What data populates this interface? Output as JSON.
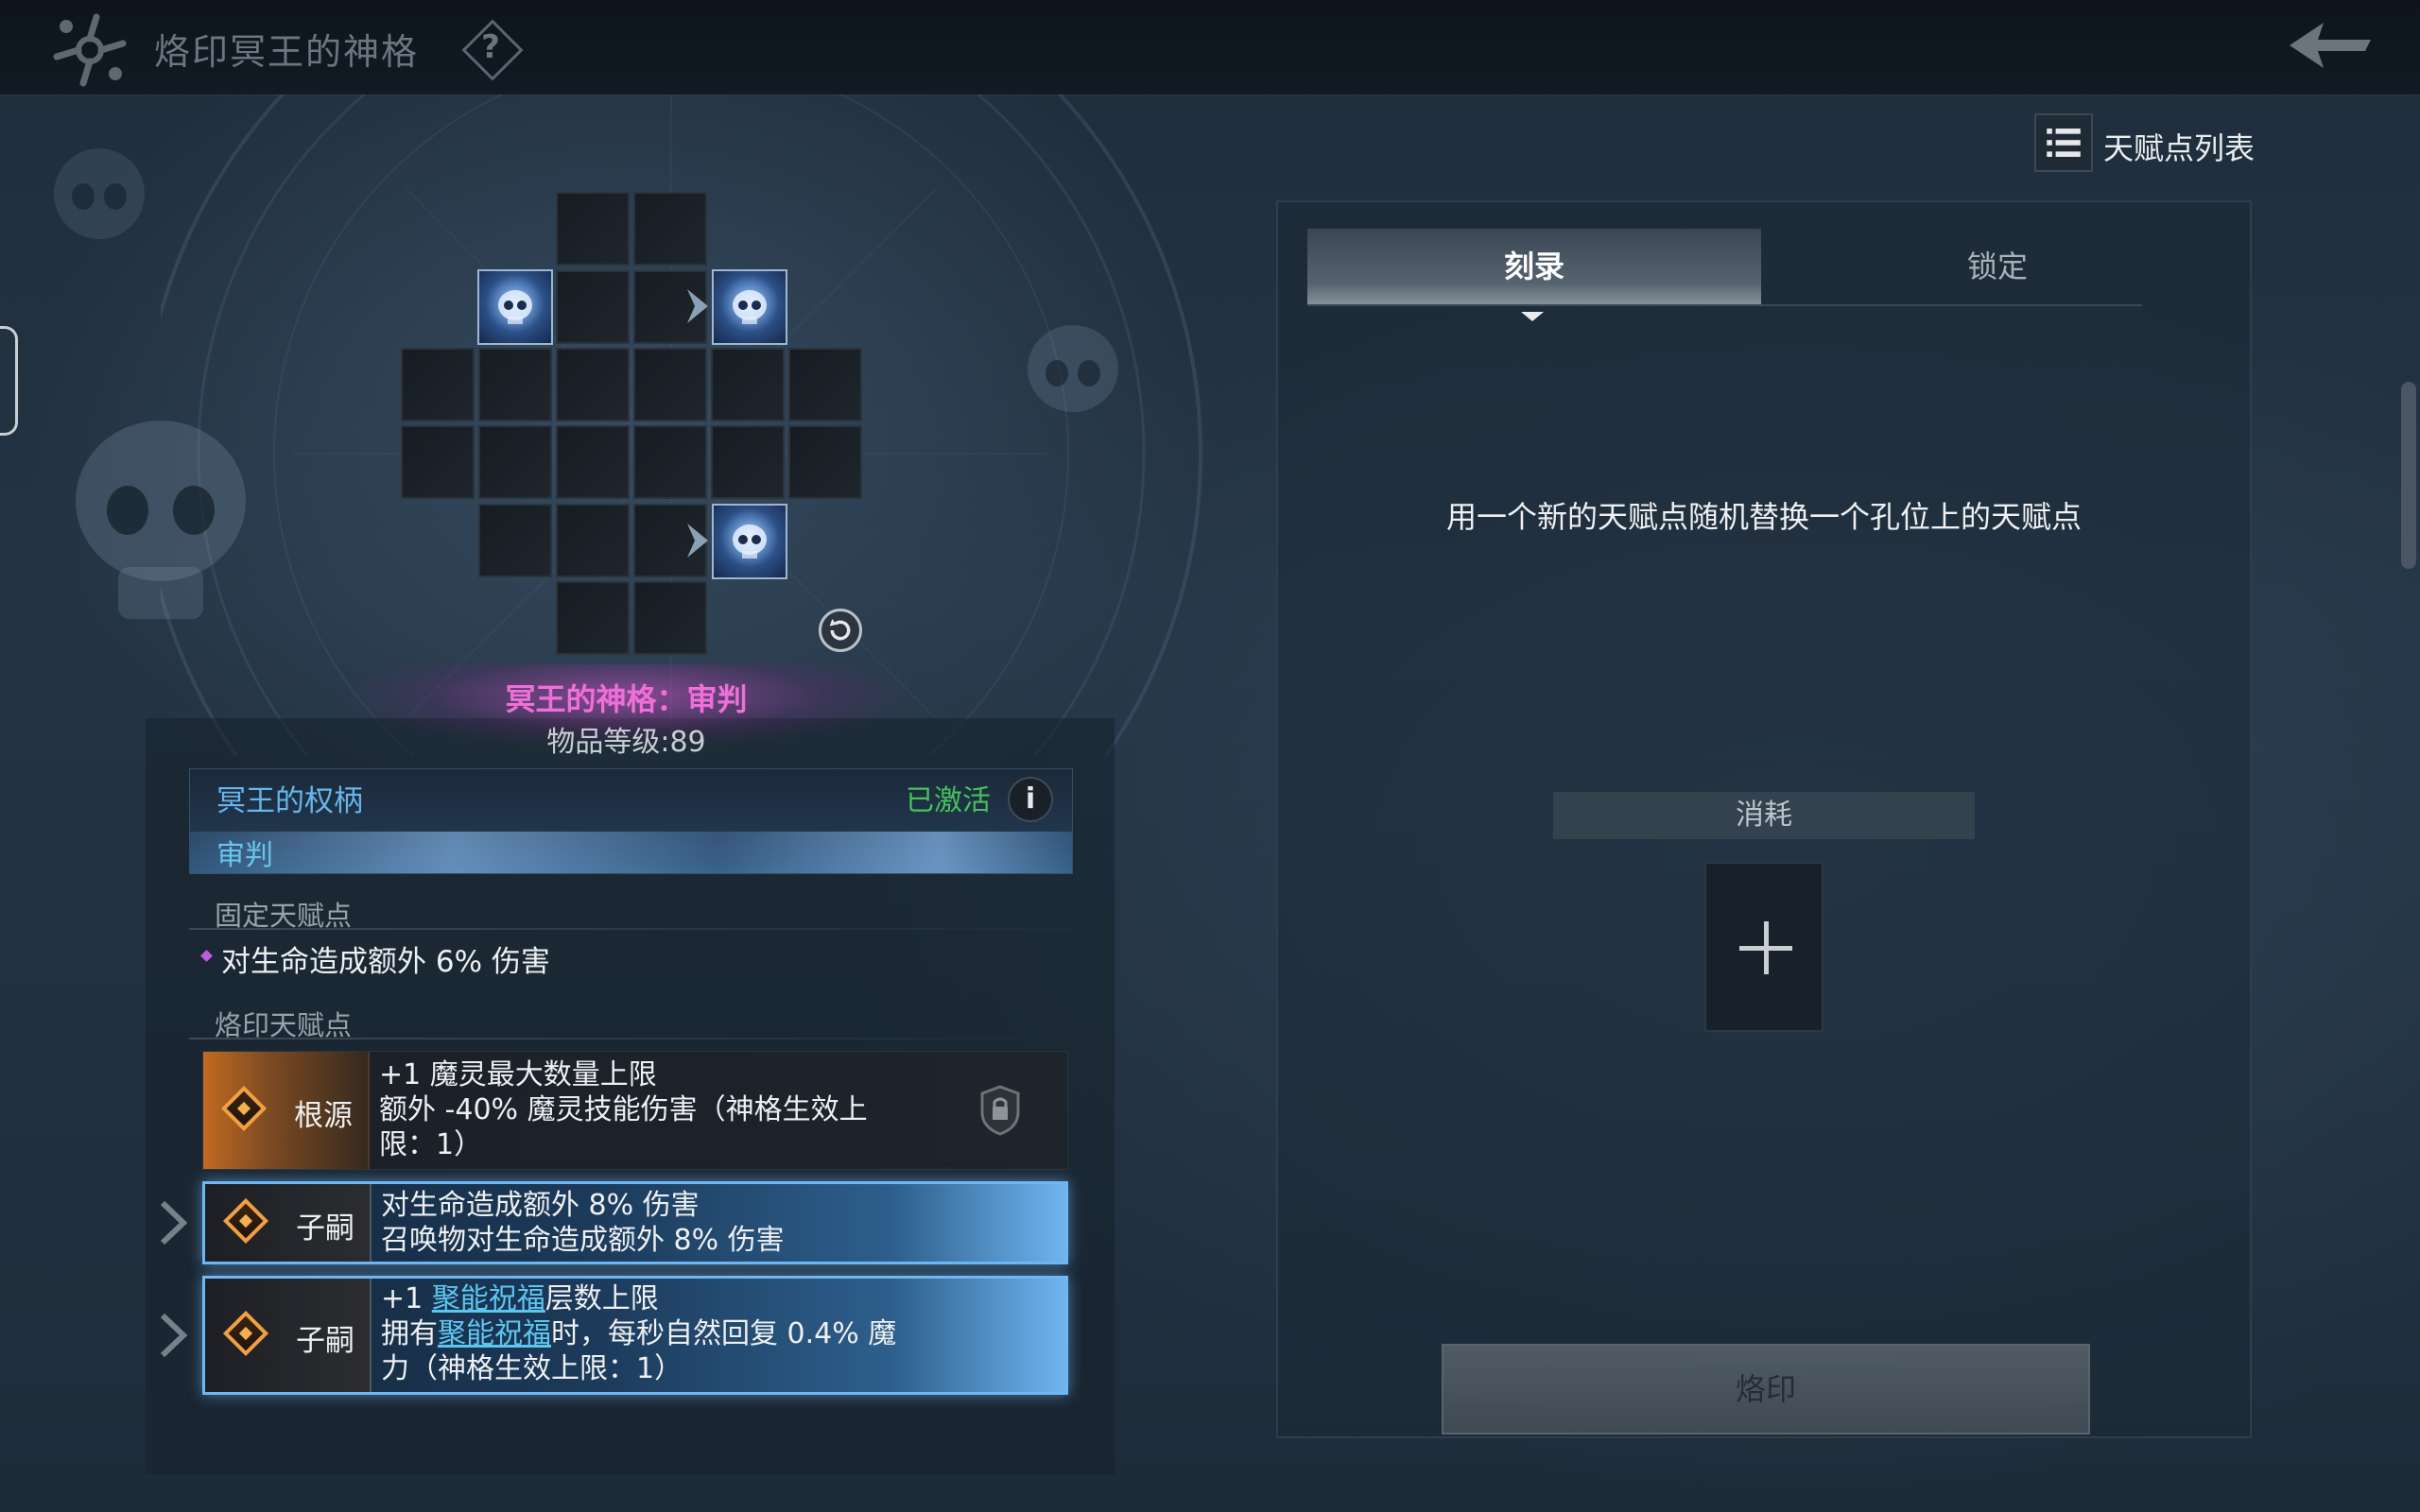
{
  "header": {
    "title": "烙印冥王的神格",
    "help_label": "?"
  },
  "item": {
    "name": "冥王的神格：审判",
    "level": "物品等级:89"
  },
  "scepter": {
    "name": "冥王的权柄",
    "sub": "审判",
    "status": "已激活",
    "info_label": "i"
  },
  "sections": {
    "fixed": "固定天赋点",
    "engraved": "烙印天赋点"
  },
  "fixed_talent": "对生命造成额外 6% 伤害",
  "talents": [
    {
      "type": "根源",
      "lines": [
        "+1 魔灵最大数量上限",
        "额外 -40% 魔灵技能伤害（神格生效上",
        "限：1）"
      ]
    },
    {
      "type": "子嗣",
      "lines": [
        "对生命造成额外 8% 伤害",
        "召唤物对生命造成额外 8% 伤害"
      ]
    },
    {
      "type": "子嗣",
      "line1_pre": "+1 ",
      "line1_link": "聚能祝福",
      "line1_post": "层数上限",
      "line2_pre": "拥有",
      "line2_link": "聚能祝福",
      "line2_post": "时，每秒自然回复 0.4% 魔",
      "line3": "力（神格生效上限：1）"
    }
  ],
  "right": {
    "talent_list_label": "天赋点列表",
    "tabs": [
      "刻录",
      "锁定"
    ],
    "description": "用一个新的天赋点随机替换一个孔位上的天赋点",
    "cost_label": "消耗",
    "engrave_label": "烙印"
  },
  "colors": {
    "accent_pink": "#ef6fd8",
    "activated_green": "#45c25c",
    "link_blue": "#5cc6f0",
    "root_orange": "#c26a22"
  }
}
